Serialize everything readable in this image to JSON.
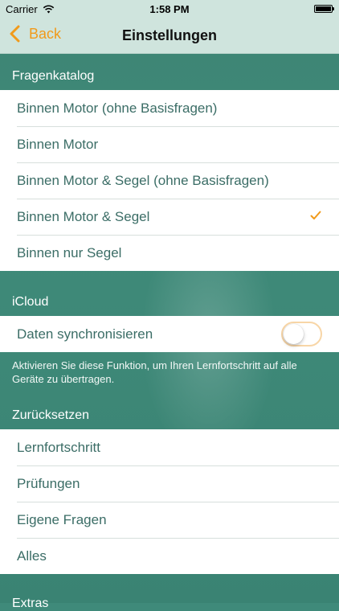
{
  "status": {
    "carrier": "Carrier",
    "time": "1:58 PM"
  },
  "nav": {
    "back_label": "Back",
    "title": "Einstellungen"
  },
  "sections": {
    "fragenkatalog": {
      "header": "Fragenkatalog",
      "items": [
        {
          "label": "Binnen Motor (ohne Basisfragen)"
        },
        {
          "label": "Binnen Motor"
        },
        {
          "label": "Binnen Motor & Segel (ohne Basisfragen)"
        },
        {
          "label": "Binnen Motor & Segel",
          "selected": true
        },
        {
          "label": "Binnen nur Segel"
        }
      ]
    },
    "icloud": {
      "header": "iCloud",
      "sync_label": "Daten synchronisieren",
      "sync_enabled": false,
      "footer": "Aktivieren Sie diese Funktion, um Ihren Lernfortschritt auf alle Geräte zu übertragen."
    },
    "reset": {
      "header": "Zurücksetzen",
      "items": [
        {
          "label": "Lernfortschritt"
        },
        {
          "label": "Prüfungen"
        },
        {
          "label": "Eigene Fragen"
        },
        {
          "label": "Alles"
        }
      ]
    },
    "extras": {
      "header": "Extras"
    }
  },
  "colors": {
    "accent": "#f19a1a",
    "background": "#3f8a7a",
    "bar": "#cfe4dd",
    "row_text": "#3b6d66"
  },
  "icons": {
    "back": "chevron-left-icon",
    "check": "checkmark-icon",
    "wifi": "wifi-icon",
    "battery": "battery-icon"
  }
}
